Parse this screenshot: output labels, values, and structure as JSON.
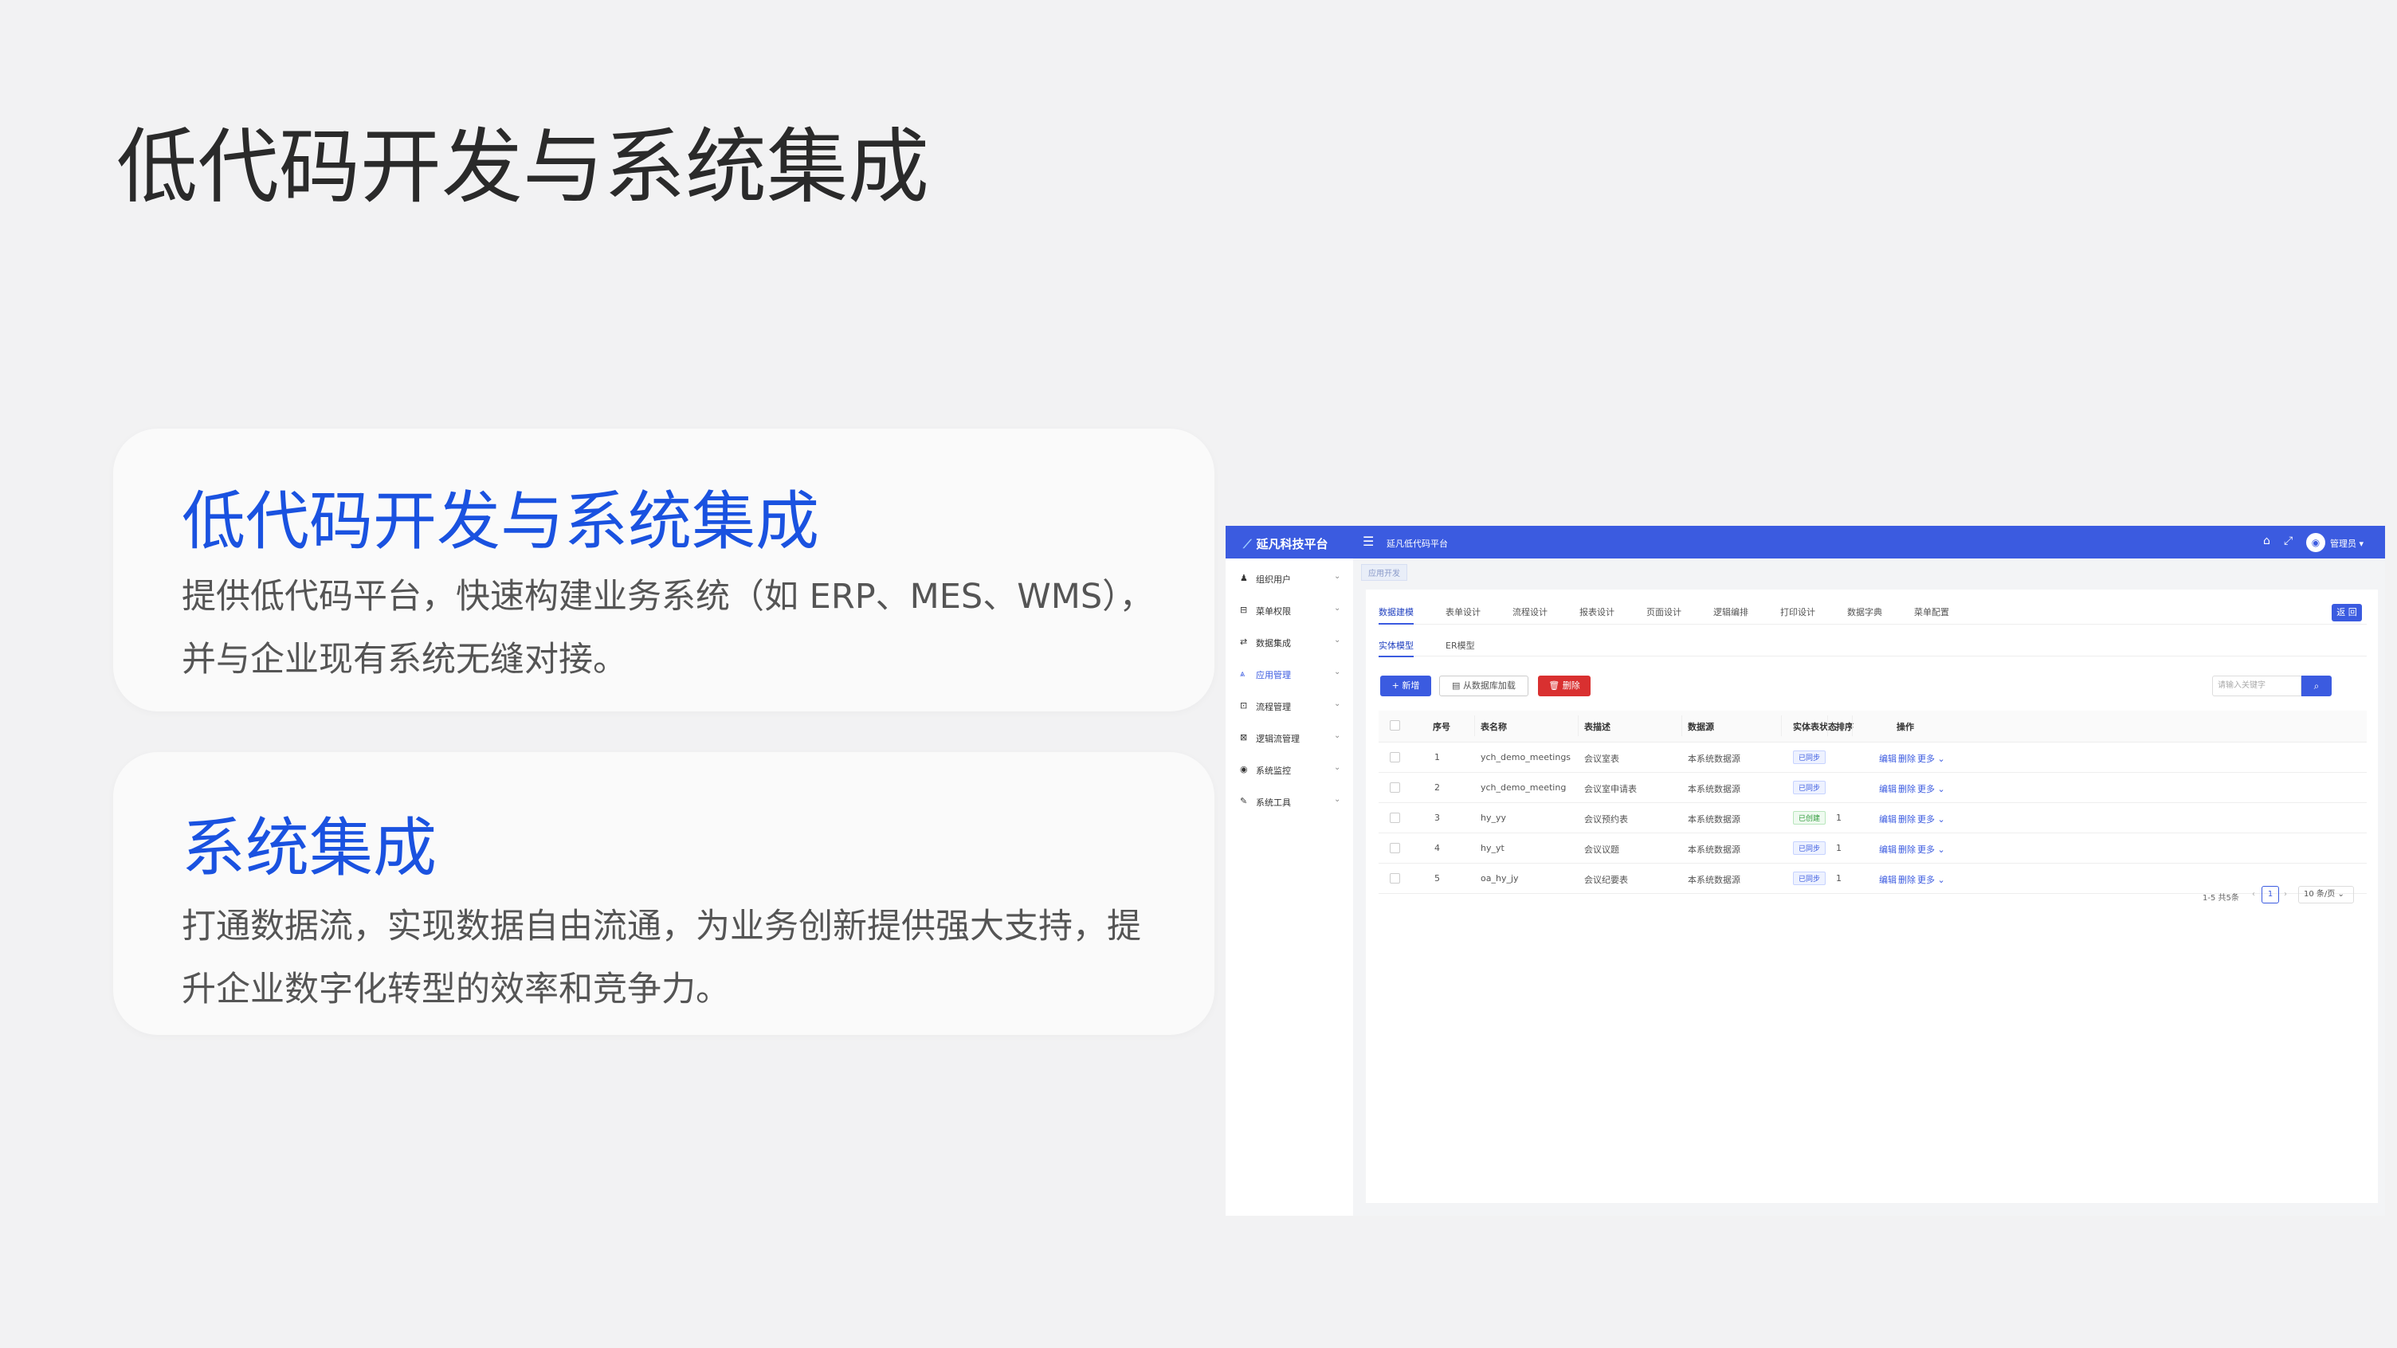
{
  "slide": {
    "title": "低代码开发与系统集成"
  },
  "cards": [
    {
      "title": "低代码开发与系统集成",
      "body": "提供低代码平台，快速构建业务系统（如 ERP、MES、WMS），并与企业现有系统无缝对接。"
    },
    {
      "title": "系统集成",
      "body": "打通数据流，实现数据自由流通，为业务创新提供强大支持，提升企业数字化转型的效率和竞争力。"
    }
  ],
  "app": {
    "brand": "延凡科技平台",
    "subtitle": "延凡低代码平台",
    "user": "管理员",
    "colors": {
      "header": "#3b5be0",
      "accent": "#3b5be0",
      "danger": "#d93030",
      "success": "#2f9b3a"
    },
    "sidebar": [
      {
        "label": "组织用户",
        "icon": "users-icon"
      },
      {
        "label": "菜单权限",
        "icon": "lock-icon"
      },
      {
        "label": "数据集成",
        "icon": "database-icon"
      },
      {
        "label": "应用管理",
        "icon": "app-icon",
        "active": true
      },
      {
        "label": "流程管理",
        "icon": "flow-icon"
      },
      {
        "label": "逻辑流管理",
        "icon": "logic-icon"
      },
      {
        "label": "系统监控",
        "icon": "eye-icon"
      },
      {
        "label": "系统工具",
        "icon": "wrench-icon"
      }
    ],
    "breadcrumb": "应用开发",
    "tabs": [
      "数据建模",
      "表单设计",
      "流程设计",
      "报表设计",
      "页面设计",
      "逻辑编排",
      "打印设计",
      "数据字典",
      "菜单配置"
    ],
    "return_label": "返 回",
    "subtabs": [
      "实体模型",
      "ER模型"
    ],
    "buttons": {
      "add": "+ 新增",
      "load": "从数据库加载",
      "delete": "删除"
    },
    "search_placeholder": "请输入关键字",
    "table": {
      "headers": [
        "序号",
        "表名称",
        "表描述",
        "数据源",
        "实体表状态",
        "排序",
        "操作"
      ],
      "rows": [
        {
          "no": "1",
          "name": "ych_demo_meetings",
          "desc": "会议室表",
          "source": "本系统数据源",
          "status": "已同步",
          "status_color": "blue",
          "sort": ""
        },
        {
          "no": "2",
          "name": "ych_demo_meeting",
          "desc": "会议室申请表",
          "source": "本系统数据源",
          "status": "已同步",
          "status_color": "blue",
          "sort": ""
        },
        {
          "no": "3",
          "name": "hy_yy",
          "desc": "会议预约表",
          "source": "本系统数据源",
          "status": "已创建",
          "status_color": "green",
          "sort": "1"
        },
        {
          "no": "4",
          "name": "hy_yt",
          "desc": "会议议题",
          "source": "本系统数据源",
          "status": "已同步",
          "status_color": "blue",
          "sort": "1"
        },
        {
          "no": "5",
          "name": "oa_hy_jy",
          "desc": "会议纪要表",
          "source": "本系统数据源",
          "status": "已同步",
          "status_color": "blue",
          "sort": "1"
        }
      ],
      "ops": {
        "edit": "编辑",
        "delete": "删除",
        "more": "更多 ⌄"
      }
    },
    "pager": {
      "summary": "1-5 共5条",
      "page": "1",
      "size": "10 条/页 ⌄"
    }
  }
}
